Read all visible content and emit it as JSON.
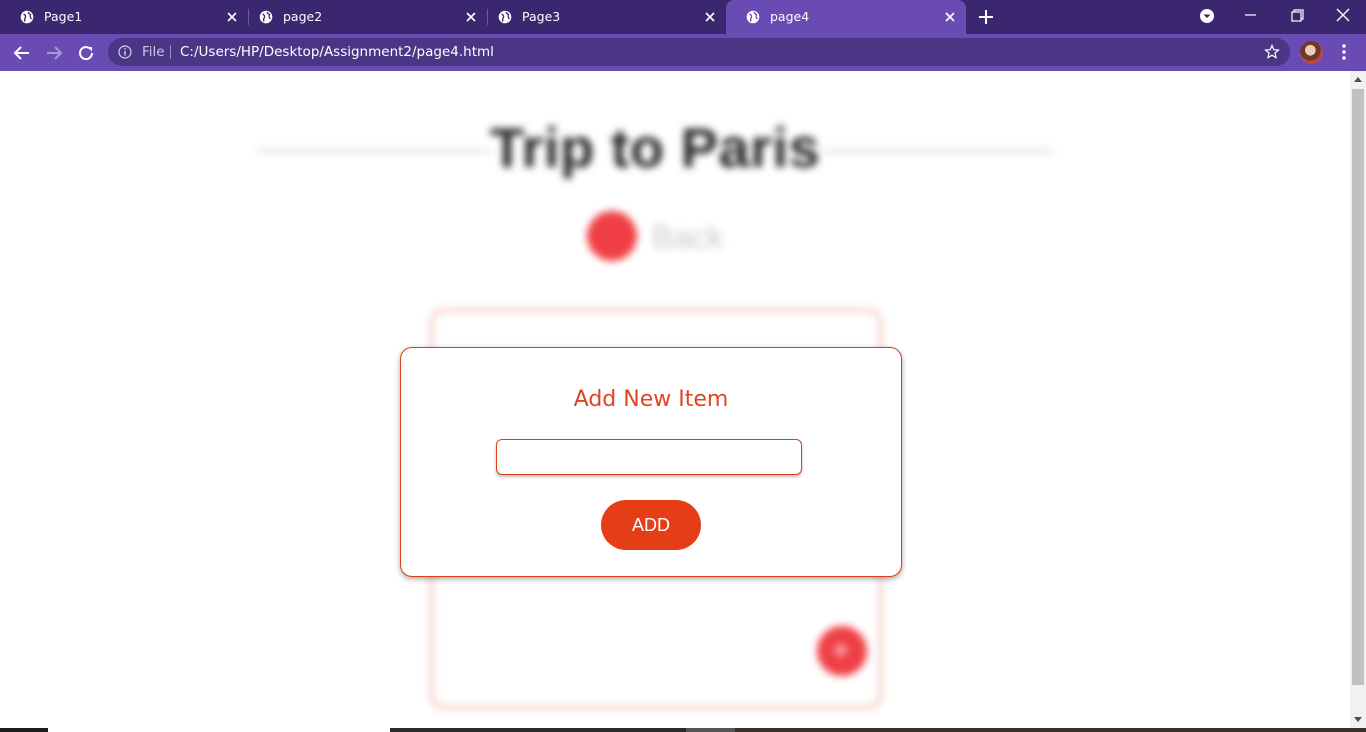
{
  "browser": {
    "tabs": [
      {
        "title": "Page1",
        "active": false
      },
      {
        "title": "page2",
        "active": false
      },
      {
        "title": "Page3",
        "active": false
      },
      {
        "title": "page4",
        "active": true
      }
    ],
    "omnibox": {
      "scheme_label": "File",
      "url": "C:/Users/HP/Desktop/Assignment2/page4.html"
    }
  },
  "page": {
    "title": "Trip to Paris",
    "back_label": "Back",
    "fab_symbol": "+"
  },
  "modal": {
    "title": "Add New Item",
    "input_value": "",
    "input_placeholder": "",
    "add_label": "ADD"
  },
  "colors": {
    "tabbar": "#3b2770",
    "toolbar": "#6a4bb3",
    "accent": "#e53e16",
    "back_button": "#ef3f45"
  },
  "icons": {
    "tab_favicon": "globe-icon",
    "tab_close": "close-icon",
    "new_tab": "plus-icon",
    "back": "arrow-left-icon",
    "forward": "arrow-right-icon",
    "reload": "reload-icon",
    "site_info": "info-icon",
    "bookmark": "star-icon",
    "menu": "kebab-menu-icon"
  }
}
